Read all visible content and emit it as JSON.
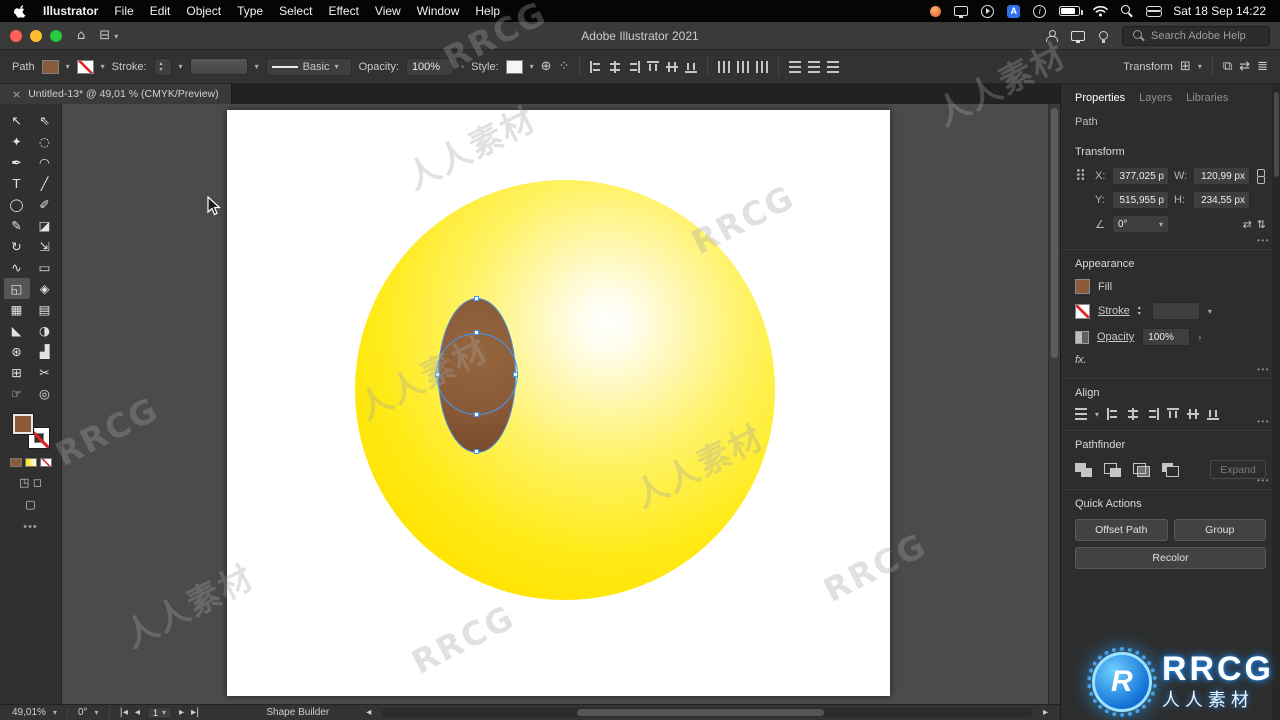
{
  "menubar": {
    "app": "Illustrator",
    "menus": [
      "File",
      "Edit",
      "Object",
      "Type",
      "Select",
      "Effect",
      "View",
      "Window",
      "Help"
    ],
    "clock": "Sat 18 Sep 14:22"
  },
  "titlebar": {
    "title": "Adobe Illustrator 2021",
    "search": "Search Adobe Help"
  },
  "controlbar": {
    "object_type": "Path",
    "stroke_label": "Stroke:",
    "line_style": "Basic",
    "opacity_label": "Opacity:",
    "opacity_value": "100%",
    "style_label": "Style:",
    "transform_label": "Transform"
  },
  "tabbar": {
    "doc_title": "Untitled-13* @ 49,01 % (CMYK/Preview)"
  },
  "tools": [
    {
      "name": "selection",
      "glyph": "↖"
    },
    {
      "name": "direct-selection",
      "glyph": "⇖"
    },
    {
      "name": "magic-wand",
      "glyph": "✦"
    },
    {
      "name": "lasso",
      "glyph": "◌"
    },
    {
      "name": "pen",
      "glyph": "✒"
    },
    {
      "name": "curvature",
      "glyph": "◠"
    },
    {
      "name": "type",
      "glyph": "T"
    },
    {
      "name": "line-segment",
      "glyph": "╱"
    },
    {
      "name": "ellipse",
      "glyph": "◯"
    },
    {
      "name": "paintbrush",
      "glyph": "✐"
    },
    {
      "name": "shaper",
      "glyph": "✎"
    },
    {
      "name": "eraser",
      "glyph": "◪"
    },
    {
      "name": "rotate",
      "glyph": "↻"
    },
    {
      "name": "scale",
      "glyph": "⇲"
    },
    {
      "name": "width",
      "glyph": "∿"
    },
    {
      "name": "free-transform",
      "glyph": "▭"
    },
    {
      "name": "shape-builder",
      "glyph": "◱"
    },
    {
      "name": "perspective-grid",
      "glyph": "◈"
    },
    {
      "name": "mesh",
      "glyph": "▦"
    },
    {
      "name": "gradient",
      "glyph": "▤"
    },
    {
      "name": "eyedropper",
      "glyph": "◣"
    },
    {
      "name": "blend",
      "glyph": "◑"
    },
    {
      "name": "symbol-sprayer",
      "glyph": "⊛"
    },
    {
      "name": "column-graph",
      "glyph": "▟"
    },
    {
      "name": "artboard",
      "glyph": "⊞"
    },
    {
      "name": "slice",
      "glyph": "✂"
    },
    {
      "name": "hand",
      "glyph": "☞"
    },
    {
      "name": "zoom",
      "glyph": "◎"
    }
  ],
  "statusbar": {
    "zoom": "49,01%",
    "rotation": "0°",
    "artboard": "1",
    "tool": "Shape Builder"
  },
  "panel": {
    "tabs": [
      "Properties",
      "Layers",
      "Libraries"
    ],
    "object_type": "Path",
    "transform": {
      "title": "Transform",
      "x_label": "X:",
      "x_value": "377,025 p",
      "y_label": "Y:",
      "y_value": "515,955 p",
      "w_label": "W:",
      "w_value": "120,99 px",
      "h_label": "H:",
      "h_value": "234,55 px",
      "angle_value": "0°"
    },
    "appearance": {
      "title": "Appearance",
      "fill_label": "Fill",
      "stroke_label": "Stroke",
      "opacity_label": "Opacity",
      "opacity_value": "100%",
      "fx": "fx."
    },
    "align": {
      "title": "Align"
    },
    "pathfinder": {
      "title": "Pathfinder",
      "expand": "Expand"
    },
    "quick_actions": {
      "title": "Quick Actions",
      "offset_path": "Offset Path",
      "group": "Group",
      "recolor": "Recolor"
    }
  },
  "watermarks": [
    "RRCG",
    "人人素材",
    "RRCG",
    "人人素材",
    "人人素材",
    "RRCG",
    "人人素材",
    "人人素材",
    "RRCG",
    "RRCG"
  ],
  "logo": {
    "brand": "RRCG",
    "brand_cn": "人人素材"
  },
  "colors": {
    "accent": "#3f9bfa",
    "ball_edge": "#ffe400",
    "ellipse_fill": "#8a5a3a",
    "brand_blue": "#1f8fff"
  }
}
